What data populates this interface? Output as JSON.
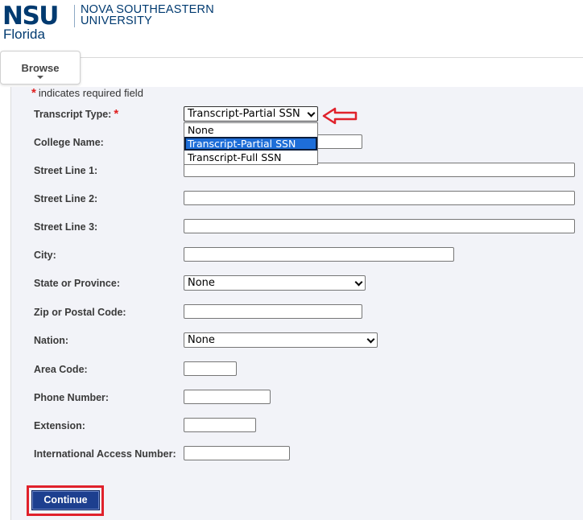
{
  "header": {
    "logo_abbr": "NSU",
    "logo_state": "Florida",
    "logo_name_line1": "NOVA SOUTHEASTERN",
    "logo_name_line2": "UNIVERSITY"
  },
  "nav": {
    "browse_label": "Browse"
  },
  "form": {
    "required_note": "indicates required field",
    "required_marker": "*",
    "fields": {
      "transcript_type": {
        "label": "Transcript Type:",
        "value": "Transcript-Partial SSN"
      },
      "college_name": {
        "label": "College Name:",
        "value": ""
      },
      "street1": {
        "label": "Street Line 1:",
        "value": ""
      },
      "street2": {
        "label": "Street Line 2:",
        "value": ""
      },
      "street3": {
        "label": "Street Line 3:",
        "value": ""
      },
      "city": {
        "label": "City:",
        "value": ""
      },
      "state": {
        "label": "State or Province:",
        "value": "None"
      },
      "zip": {
        "label": "Zip or Postal Code:",
        "value": ""
      },
      "nation": {
        "label": "Nation:",
        "value": "None"
      },
      "area_code": {
        "label": "Area Code:",
        "value": ""
      },
      "phone": {
        "label": "Phone Number:",
        "value": ""
      },
      "extension": {
        "label": "Extension:",
        "value": ""
      },
      "intl_access": {
        "label": "International Access Number:",
        "value": ""
      }
    },
    "transcript_options": [
      "None",
      "Transcript-Partial SSN",
      "Transcript-Full SSN"
    ],
    "continue_label": "Continue"
  },
  "colors": {
    "brand_navy": "#003a70",
    "required_red": "#e02020",
    "highlight_red": "#e0212b",
    "selected_option": "#1e6ed8",
    "button_blue": "#1d3f8f"
  }
}
